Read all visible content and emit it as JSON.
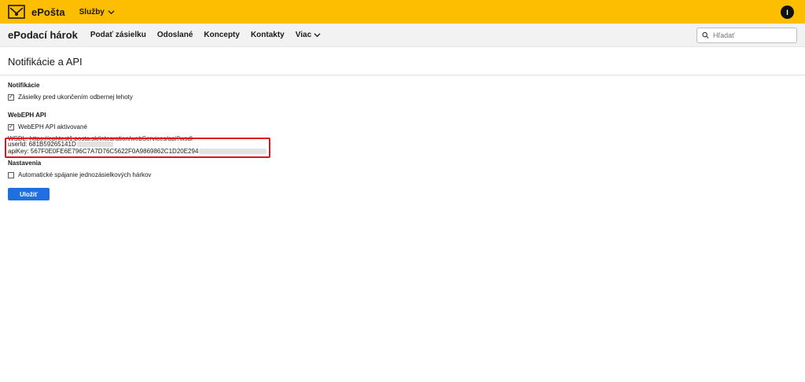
{
  "header": {
    "brand": "ePošta",
    "services_label": "Služby",
    "user_initial": "I"
  },
  "nav": {
    "app_title": "ePodací hárok",
    "items": [
      {
        "label": "Podať zásielku"
      },
      {
        "label": "Odoslané"
      },
      {
        "label": "Koncepty"
      },
      {
        "label": "Kontakty"
      },
      {
        "label": "Viac"
      }
    ],
    "search_placeholder": "Hľadať"
  },
  "page": {
    "title": "Notifikácie a API"
  },
  "notifications": {
    "title": "Notifikácie",
    "checkbox_label": "Zásielky pred ukončením odbernej lehoty",
    "checked": true
  },
  "webeph": {
    "title": "WebEPH API",
    "checkbox_label": "WebEPH API aktivované",
    "checked": true,
    "wsdl": "WSDL: https://ephtest1.posta.sk/integration/webServices/api?wsdl",
    "userid": "userId: 681B59265141D",
    "apikey": "apiKey: 567F0E0FE6E796C7A7D76C5622F0A9869862C1D20E294"
  },
  "settings": {
    "title": "Nastavenia",
    "checkbox_label": "Automatické spájanie jednozásielkových hárkov",
    "checked": false
  },
  "actions": {
    "save_label": "Uložiť"
  },
  "colors": {
    "brand_yellow": "#fdbd00",
    "primary_blue": "#1f6fe0",
    "highlight_red": "#e0141c"
  }
}
